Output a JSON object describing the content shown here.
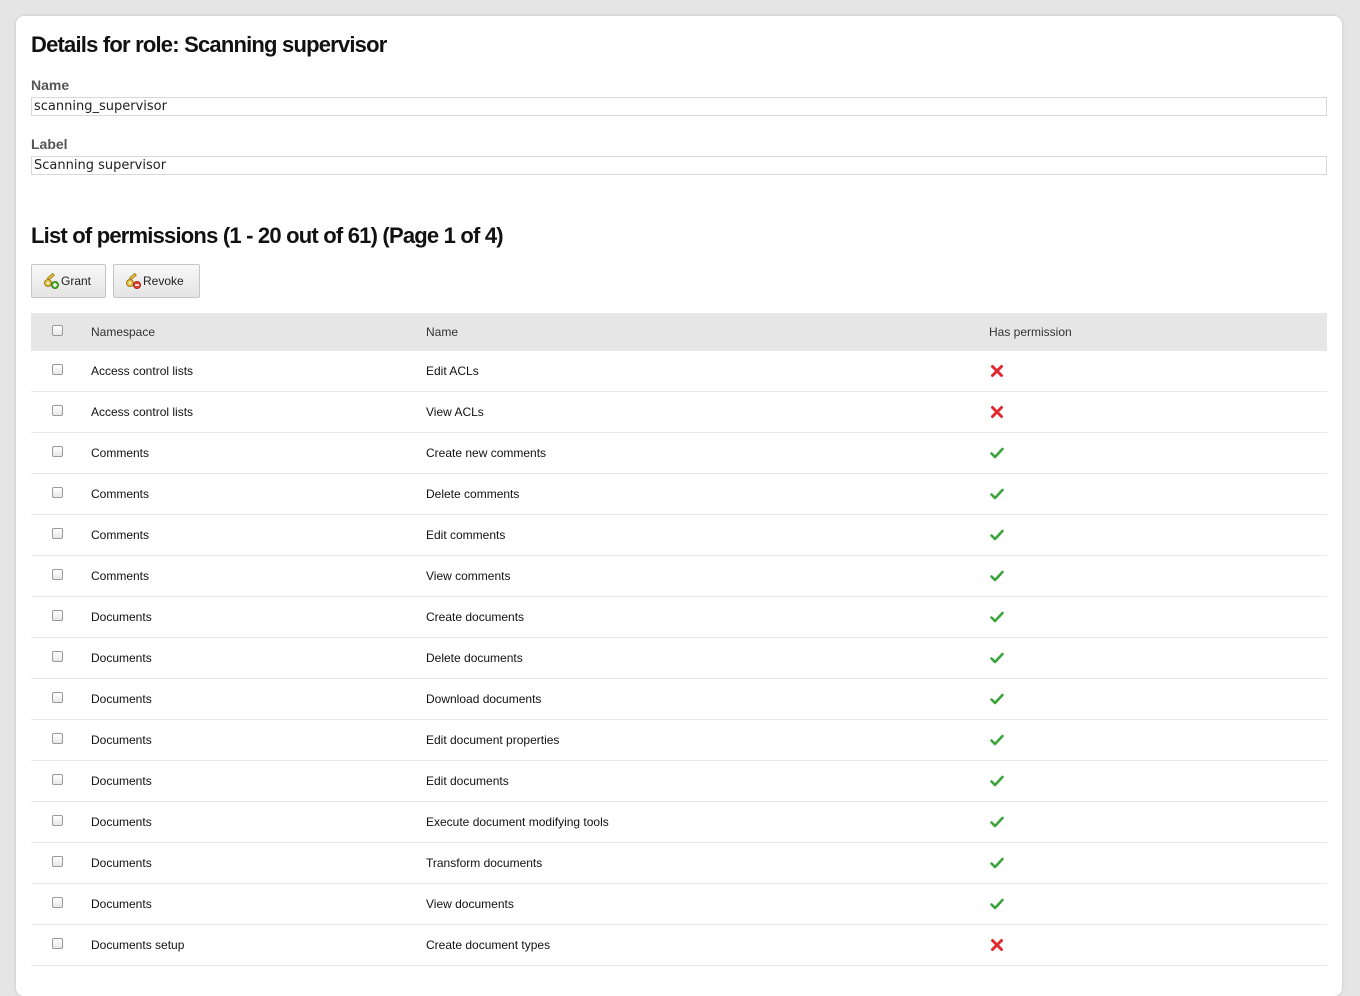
{
  "page": {
    "title": "Details for role: Scanning supervisor",
    "name_label": "Name",
    "name_value": "scanning_supervisor",
    "label_label": "Label",
    "label_value": "Scanning supervisor",
    "list_title": "List of permissions (1 - 20 out of 61) (Page 1 of 4)"
  },
  "toolbar": {
    "grant_label": "Grant",
    "revoke_label": "Revoke",
    "grant_icon": "key-add-icon",
    "revoke_icon": "key-delete-icon"
  },
  "table": {
    "columns": [
      "Namespace",
      "Name",
      "Has permission"
    ],
    "rows": [
      {
        "namespace": "Access control lists",
        "name": "Edit ACLs",
        "has": false
      },
      {
        "namespace": "Access control lists",
        "name": "View ACLs",
        "has": false
      },
      {
        "namespace": "Comments",
        "name": "Create new comments",
        "has": true
      },
      {
        "namespace": "Comments",
        "name": "Delete comments",
        "has": true
      },
      {
        "namespace": "Comments",
        "name": "Edit comments",
        "has": true
      },
      {
        "namespace": "Comments",
        "name": "View comments",
        "has": true
      },
      {
        "namespace": "Documents",
        "name": "Create documents",
        "has": true
      },
      {
        "namespace": "Documents",
        "name": "Delete documents",
        "has": true
      },
      {
        "namespace": "Documents",
        "name": "Download documents",
        "has": true
      },
      {
        "namespace": "Documents",
        "name": "Edit document properties",
        "has": true
      },
      {
        "namespace": "Documents",
        "name": "Edit documents",
        "has": true
      },
      {
        "namespace": "Documents",
        "name": "Execute document modifying tools",
        "has": true
      },
      {
        "namespace": "Documents",
        "name": "Transform documents",
        "has": true
      },
      {
        "namespace": "Documents",
        "name": "View documents",
        "has": true
      },
      {
        "namespace": "Documents setup",
        "name": "Create document types",
        "has": false
      }
    ]
  },
  "colors": {
    "check_green": "#3aa33a",
    "cross_red": "#e0282f",
    "header_bg": "#e6e6e6"
  }
}
